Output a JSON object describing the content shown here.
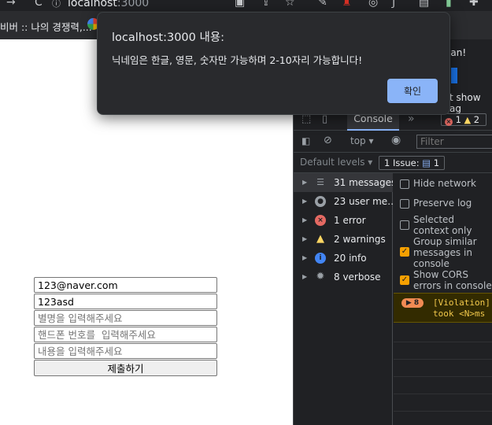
{
  "browser": {
    "url_host": "localhost",
    "url_port": ":3000",
    "bookmark_1": "비버 :: 나의 경쟁력,...",
    "bookmark_2_icon": "google-icon"
  },
  "form": {
    "email_value": "123@naver.com",
    "password_value": "123asd",
    "nickname_placeholder": "별명을 입력해주세요",
    "phone_placeholder": "핸드폰 번호를  입력해주세요",
    "content_placeholder": "내용을 입력해주세요",
    "submit_label": "제출하기"
  },
  "alert": {
    "title": "localhost:3000 내용:",
    "message": "닉네임은 한글, 영문, 숫자만 가능하며 2-10자리 가능합니다!",
    "ok_label": "확인"
  },
  "devtools": {
    "partial_text_1": "ean!",
    "partial_text_2": "t show ag",
    "tab_console": "Console",
    "error_count": "1",
    "warning_count": "2",
    "context": "top",
    "filter_placeholder": "Filter",
    "default_levels": "Default levels",
    "issues": "1 Issue:",
    "issues_count": "1",
    "sidebar": [
      {
        "label": "31 messages"
      },
      {
        "label": "23 user me…"
      },
      {
        "label": "1 error"
      },
      {
        "label": "2 warnings"
      },
      {
        "label": "20 info"
      },
      {
        "label": "8 verbose"
      }
    ],
    "settings": [
      {
        "label": "Hide network",
        "checked": false
      },
      {
        "label": "Preserve log",
        "checked": false
      },
      {
        "label": "Selected context only",
        "checked": false
      },
      {
        "label": "Group similar messages in console",
        "checked": true
      },
      {
        "label": "Show CORS errors in console",
        "checked": true
      }
    ],
    "violation_count": "8",
    "violation_text": "[Violation]\ntook <N>ms"
  },
  "colors": {
    "alert_bg": "#292a2d",
    "ok_button": "#8ab4f8",
    "devtools_bg": "#202124",
    "checkbox_on": "#f6a000"
  }
}
